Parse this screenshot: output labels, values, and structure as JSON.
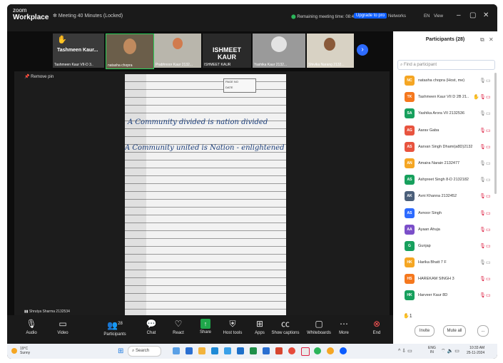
{
  "title_bar": {
    "brand_top": "zoom",
    "brand_bottom": "Workplace",
    "meeting_title": "Meeting 40 Minutes (Locked)",
    "remaining": "Remaining meeting time: 08:42",
    "upgrade": "Upgrade to pro",
    "network": "Networks",
    "language": "EN",
    "view": "View"
  },
  "strip": {
    "raised_name": "Tashmeen Kaur...",
    "tashmeen_label": "Tashmeen Kaur VII-D 3..",
    "natasha_label": "natasha chopra",
    "prabhnoor_label": "Prabhnoor Kaur 2132...",
    "ishmeet_big": "ISHMEET KAUR",
    "ishmeet_label": "ISHMEET KAUR",
    "yashika_label": "Yashika Kaur 2132...",
    "shivika_label": "Shivika Narang 2132..."
  },
  "stage": {
    "remove_pin": "Remove pin",
    "date_label": "DATE",
    "page_label": "PAGE NO",
    "line1": "A Community divided is nation divided",
    "line2": "A Community united is Nation - enlightened",
    "caption": "Shrutya Sharma 2132534"
  },
  "toolbar": {
    "audio": "Audio",
    "video": "Video",
    "participants": "Participants",
    "participants_count": "28",
    "chat": "Chat",
    "react": "React",
    "share": "Share",
    "host_tools": "Host tools",
    "apps": "Apps",
    "captions": "Show captions",
    "whiteboards": "Whiteboards",
    "more": "More",
    "end": "End"
  },
  "panel": {
    "title": "Participants (28)",
    "search_placeholder": "Find a participant",
    "raise_count": "1",
    "invite": "Invite",
    "mute_all": "Mute all",
    "more": "..."
  },
  "participants": [
    {
      "initials": "NC",
      "name": "natasha chopra (Host, me)",
      "color": "#f5a623",
      "state": "host"
    },
    {
      "initials": "TK",
      "name": "Tashmeen Kaur VII D 2B 21..",
      "color": "#f5781e",
      "state": "hand"
    },
    {
      "initials": "SA",
      "name": "Yashika Arora VII 2132536",
      "color": "#17a05d",
      "state": "cam"
    },
    {
      "initials": "AG",
      "name": "Aarav Gaba",
      "color": "#e8543f",
      "state": "muted"
    },
    {
      "initials": "AS",
      "name": "Aarvan Singh Dhami(a8D)21325..",
      "color": "#e8543f",
      "state": "muted"
    },
    {
      "initials": "AN",
      "name": "Amaira Narain 2132477",
      "color": "#f5a623",
      "state": "cam"
    },
    {
      "initials": "AS",
      "name": "Ashpreet Singh 8-D 2132182",
      "color": "#17a05d",
      "state": "cam"
    },
    {
      "initials": "AK",
      "name": "Avni Khanna 2132452",
      "color": "#4b5f7a",
      "state": "muted"
    },
    {
      "initials": "AS",
      "name": "Avnoor Singh",
      "color": "#2d6bff",
      "state": "muted"
    },
    {
      "initials": "AA",
      "name": "Ayaan Ahuja",
      "color": "#7b4fc9",
      "state": "muted"
    },
    {
      "initials": "G",
      "name": "Gunjap",
      "color": "#17a05d",
      "state": "muted"
    },
    {
      "initials": "HK",
      "name": "Harika Bhatt 7 F",
      "color": "#f5a623",
      "state": "cam"
    },
    {
      "initials": "HS",
      "name": "HAREKAM SINGH 3",
      "color": "#f5781e",
      "state": "muted"
    },
    {
      "initials": "HK",
      "name": "Harveer Kaur 8D",
      "color": "#17a05d",
      "state": "muted"
    }
  ],
  "taskbar": {
    "temp": "19°C",
    "condition": "Sunny",
    "search": "Search",
    "lang_top": "ENG",
    "lang_bottom": "IN",
    "time": "10:33 AM",
    "date": "25-11-2024"
  },
  "colors": {
    "accent": "#0b5cff",
    "share_green": "#1fa74a",
    "end_red": "#ff5555"
  }
}
